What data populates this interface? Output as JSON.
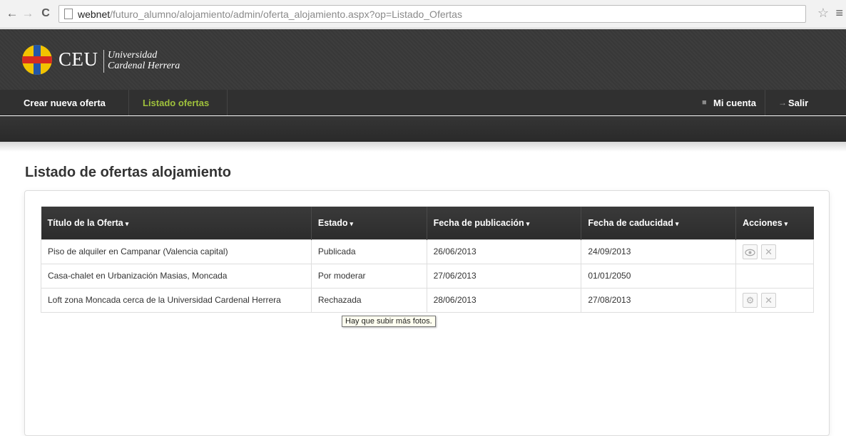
{
  "browser": {
    "url_host": "webnet",
    "url_path": "/futuro_alumno/alojamiento/admin/oferta_alojamiento.aspx?op=Listado_Ofertas"
  },
  "header": {
    "brand": "CEU",
    "university_line1": "Universidad",
    "university_line2": "Cardenal Herrera",
    "logo_colors": {
      "yellow": "#f2c300",
      "blue": "#2357a8",
      "red": "#d62b1f"
    }
  },
  "nav": {
    "crear": "Crear nueva oferta",
    "listado": "Listado ofertas",
    "mi_cuenta": "Mi cuenta",
    "salir": "Salir",
    "active_color": "#9fc13c"
  },
  "page": {
    "title": "Listado de ofertas alojamiento"
  },
  "table": {
    "headers": [
      "Título de la Oferta",
      "Estado",
      "Fecha de publicación",
      "Fecha de caducidad",
      "Acciones"
    ],
    "rows": [
      {
        "titulo": "Piso de alquiler en Campanar (Valencia capital)",
        "estado": "Publicada",
        "publicacion": "26/06/2013",
        "caducidad": "24/09/2013",
        "acciones": [
          "eye-icon",
          "close-icon"
        ]
      },
      {
        "titulo": "Casa-chalet en Urbanización Masias, Moncada",
        "estado": "Por moderar",
        "publicacion": "27/06/2013",
        "caducidad": "01/01/2050",
        "acciones": []
      },
      {
        "titulo": "Loft zona Moncada cerca de la Universidad Cardenal Herrera",
        "estado": "Rechazada",
        "publicacion": "28/06/2013",
        "caducidad": "27/08/2013",
        "acciones": [
          "gear-icon",
          "close-icon"
        ]
      }
    ]
  },
  "tooltip": {
    "text": "Hay que subir más fotos."
  },
  "status_colors": {
    "publicada": "#3a8a2a",
    "por_moderar": "#2a2aa8",
    "rechazada": "#c82020"
  }
}
